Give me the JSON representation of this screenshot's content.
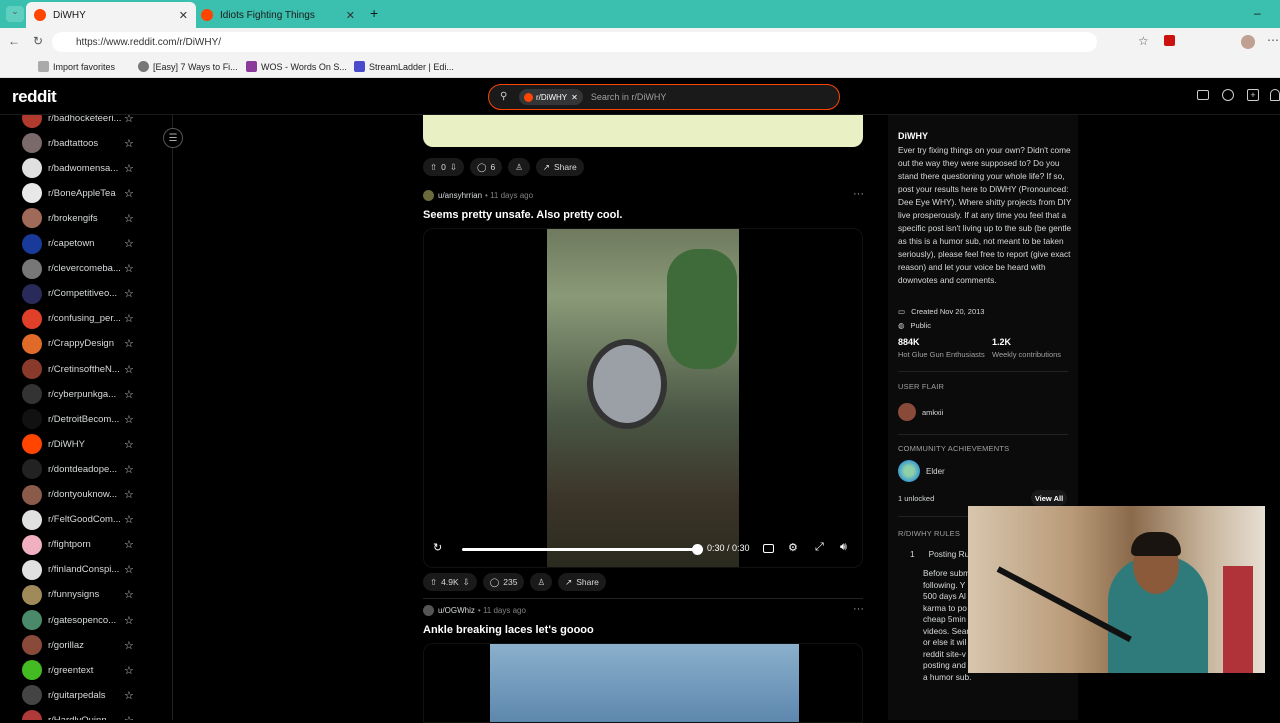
{
  "browser": {
    "tabs": [
      {
        "title": "DiWHY",
        "active": true
      },
      {
        "title": "Idiots Fighting Things",
        "active": false
      }
    ],
    "url": "https://www.reddit.com/r/DiWHY/",
    "bookmarks": [
      "Import favorites",
      "[Easy] 7 Ways to Fi...",
      "WOS - Words On S...",
      "StreamLadder | Edi..."
    ]
  },
  "reddit": {
    "logo": "reddit",
    "search_chip": "r/DiWHY",
    "search_placeholder": "Search in r/DiWHY"
  },
  "sidebar": {
    "items": [
      {
        "label": "r/badhocketeeri...",
        "color": "#b03a2e"
      },
      {
        "label": "r/badtattoos",
        "color": "#7a6a6a"
      },
      {
        "label": "r/badwomensa...",
        "color": "#e0e0e0"
      },
      {
        "label": "r/BoneAppleTea",
        "color": "#e8e8e8"
      },
      {
        "label": "r/brokengifs",
        "color": "#a06a5a"
      },
      {
        "label": "r/capetown",
        "color": "#1a3a9a"
      },
      {
        "label": "r/clevercomeba...",
        "color": "#777"
      },
      {
        "label": "r/Competitiveo...",
        "color": "#2a2a5a"
      },
      {
        "label": "r/confusing_per...",
        "color": "#e0402a"
      },
      {
        "label": "r/CrappyDesign",
        "color": "#e06a2a"
      },
      {
        "label": "r/CretinsoftheN...",
        "color": "#8a3a2a"
      },
      {
        "label": "r/cyberpunkga...",
        "color": "#333"
      },
      {
        "label": "r/DetroitBecom...",
        "color": "#111"
      },
      {
        "label": "r/DiWHY",
        "color": "#ff4500"
      },
      {
        "label": "r/dontdeadope...",
        "color": "#222"
      },
      {
        "label": "r/dontyouknow...",
        "color": "#8a5a4a"
      },
      {
        "label": "r/FeltGoodCom...",
        "color": "#e0e0e0"
      },
      {
        "label": "r/fightporn",
        "color": "#f0b0c0"
      },
      {
        "label": "r/finlandConspi...",
        "color": "#e0e0e0"
      },
      {
        "label": "r/funnysigns",
        "color": "#a08a5a"
      },
      {
        "label": "r/gatesopenco...",
        "color": "#4a8a6a"
      },
      {
        "label": "r/gorillaz",
        "color": "#8a4a3a"
      },
      {
        "label": "r/greentext",
        "color": "#44bb22"
      },
      {
        "label": "r/guitarpedals",
        "color": "#444"
      },
      {
        "label": "r/HardlyQuinn",
        "color": "#b03a3a"
      }
    ]
  },
  "feed": {
    "post0": {
      "votes": "0",
      "comments": "6",
      "share": "Share"
    },
    "post1": {
      "author": "u/ansyhrrian",
      "age": "11 days ago",
      "title": "Seems pretty unsafe. Also pretty cool.",
      "time": "0:30 / 0:30",
      "progress": 1.0,
      "votes": "4.9K",
      "comments": "235",
      "share": "Share"
    },
    "post2": {
      "author": "u/OGWhiz",
      "age": "11 days ago",
      "title": "Ankle breaking laces let's goooo"
    }
  },
  "community": {
    "name": "DiWHY",
    "description": "Ever try fixing things on your own? Didn't come out the way they were supposed to? Do you stand there questioning your whole life? If so, post your results here to DiWHY (Pronounced: Dee Eye WHY). Where shitty projects from DIY live prosperously. If at any time you feel that a specific post isn't living up to the sub (be gentle as this is a humor sub, not meant to be taken seriously), please feel free to report (give exact reason) and let your voice be heard with downvotes and comments.",
    "created": "Created Nov 20, 2013",
    "visibility": "Public",
    "members": "884K",
    "members_label": "Hot Glue Gun Enthusiasts",
    "contributions": "1.2K",
    "contributions_label": "Weekly contributions",
    "user_flair_heading": "USER FLAIR",
    "user_flair_name": "amkxii",
    "achievements_heading": "COMMUNITY ACHIEVEMENTS",
    "achievement_name": "Elder",
    "unlocked": "1 unlocked",
    "view_all": "View All",
    "rules_heading": "R/DIWHY RULES",
    "rule_number": "1",
    "rule_title": "Posting Ru",
    "rule_text_lines": [
      "Before subm",
      "following. Y",
      "500 days Al",
      "karma to po",
      "cheap 5min",
      "videos. Sear",
      "or else it wil",
      "reddit site-v",
      "posting and please remember this is",
      "a humor sub."
    ]
  }
}
